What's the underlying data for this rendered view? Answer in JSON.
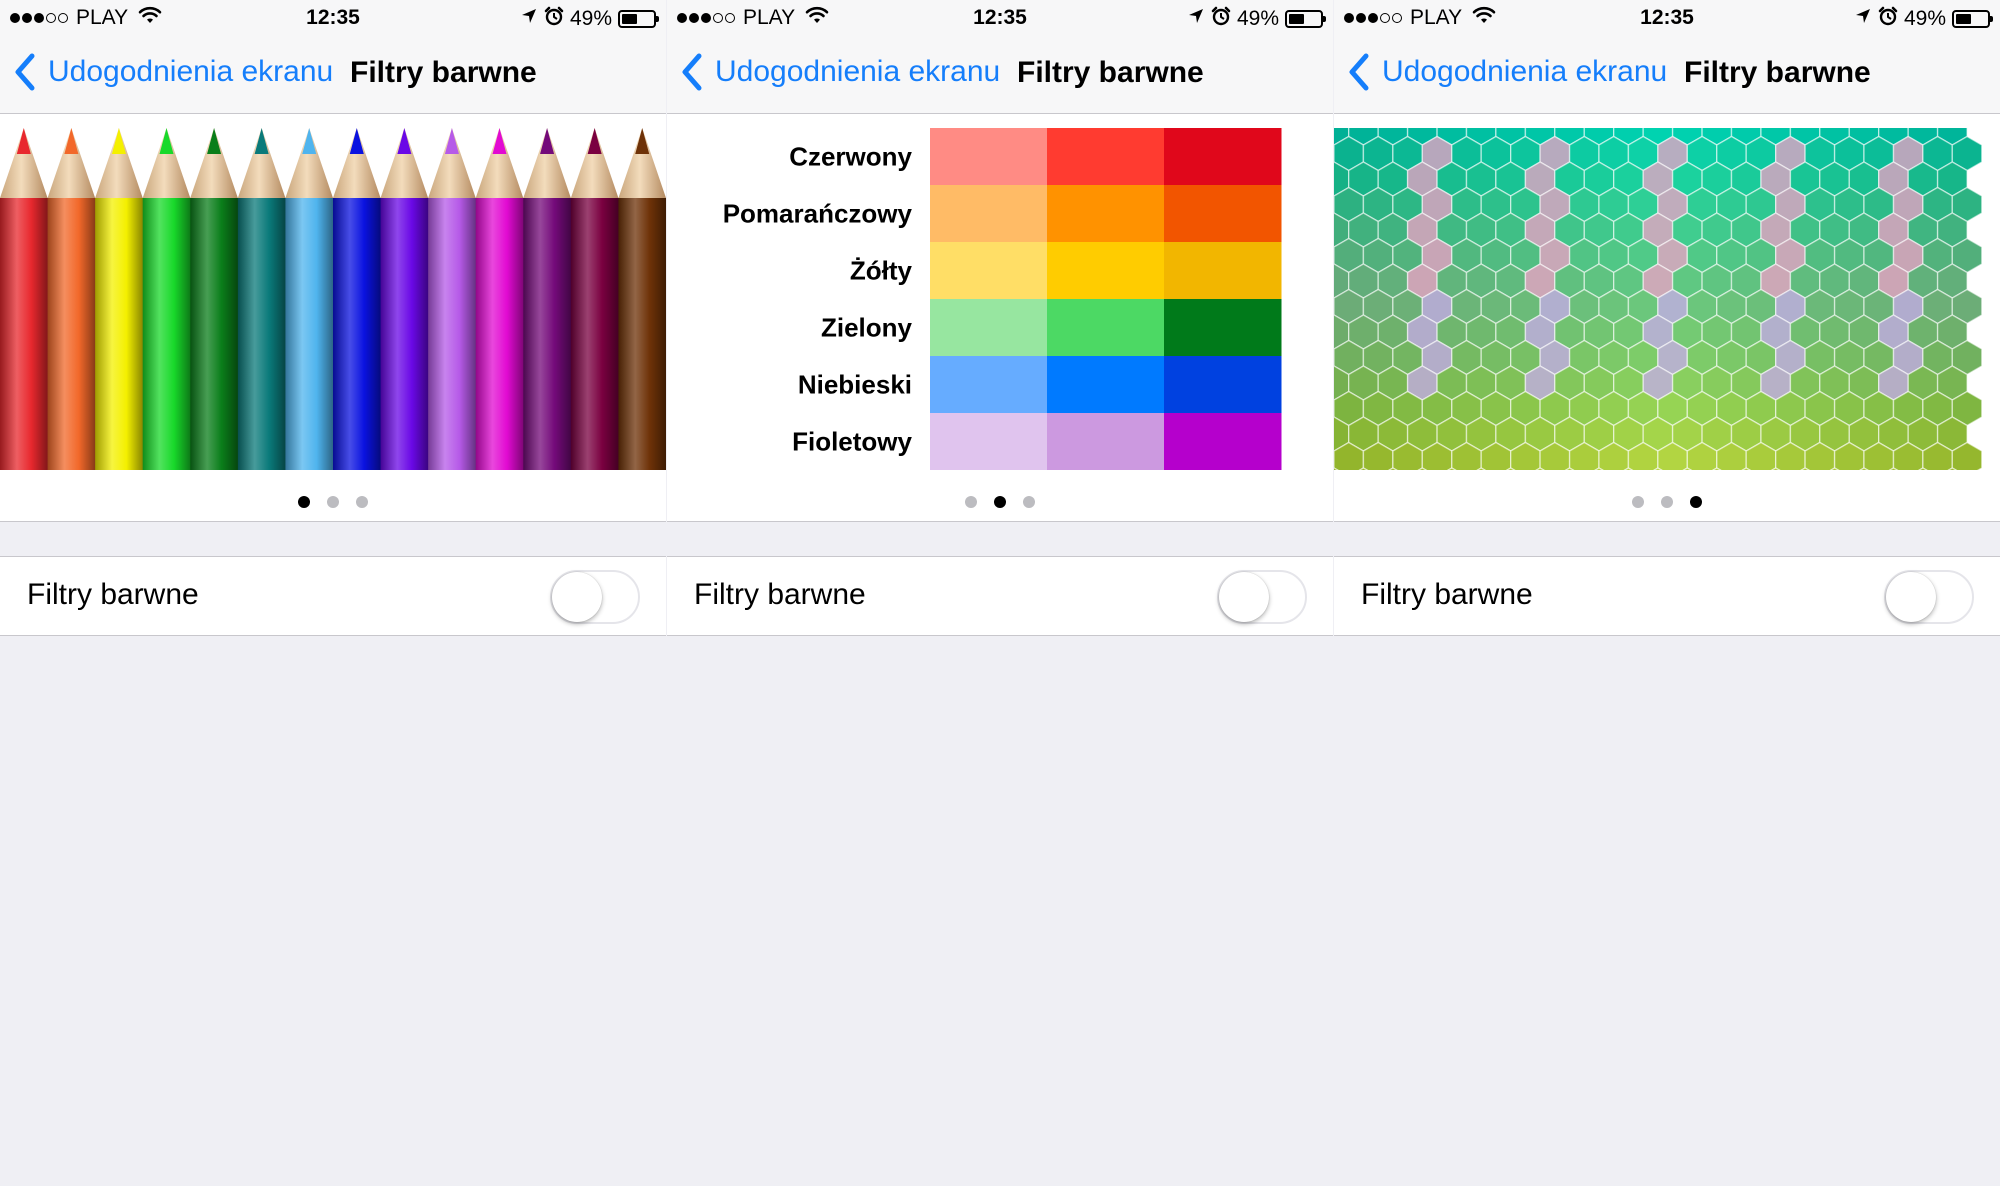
{
  "status_bar": {
    "carrier": "PLAY",
    "signal_bars_filled": 3,
    "signal_bars_total": 5,
    "time": "12:35",
    "battery_percent": "49%",
    "battery_level": 0.49,
    "icons": [
      "wifi-icon",
      "location-arrow-icon",
      "alarm-clock-icon",
      "battery-icon"
    ]
  },
  "nav": {
    "back_label": "Udogodnienia ekranu",
    "title": "Filtry barwne"
  },
  "toggle": {
    "label": "Filtry barwne",
    "on": false
  },
  "pages": {
    "count": 3,
    "active_per_screen": [
      0,
      1,
      2
    ]
  },
  "pencils": {
    "colors": [
      "#e8282e",
      "#f2682a",
      "#f4f000",
      "#18d92a",
      "#0a7e1a",
      "#0a7a7a",
      "#4fb4ee",
      "#0a12e0",
      "#6a08e6",
      "#b65ae8",
      "#e20ad2",
      "#740a7a",
      "#7a0040",
      "#6e3208"
    ]
  },
  "color_grid": {
    "rows": [
      {
        "label": "Czerwony",
        "swatches": [
          "#ff8b84",
          "#ff3b30",
          "#e0071b"
        ]
      },
      {
        "label": "Pomarańczowy",
        "swatches": [
          "#ffbb66",
          "#ff9200",
          "#f25500"
        ]
      },
      {
        "label": "Żółty",
        "swatches": [
          "#ffde66",
          "#ffcc00",
          "#f2b600"
        ]
      },
      {
        "label": "Zielony",
        "swatches": [
          "#97e6a0",
          "#4cd964",
          "#007a1a"
        ]
      },
      {
        "label": "Niebieski",
        "swatches": [
          "#66acff",
          "#007aff",
          "#0041e0"
        ]
      },
      {
        "label": "Fioletowy",
        "swatches": [
          "#e0c4ee",
          "#cc99e0",
          "#b500cc"
        ]
      }
    ]
  },
  "colors": {
    "accent": "#157efb",
    "background": "#efeff4",
    "separator": "#c8c7cc"
  }
}
